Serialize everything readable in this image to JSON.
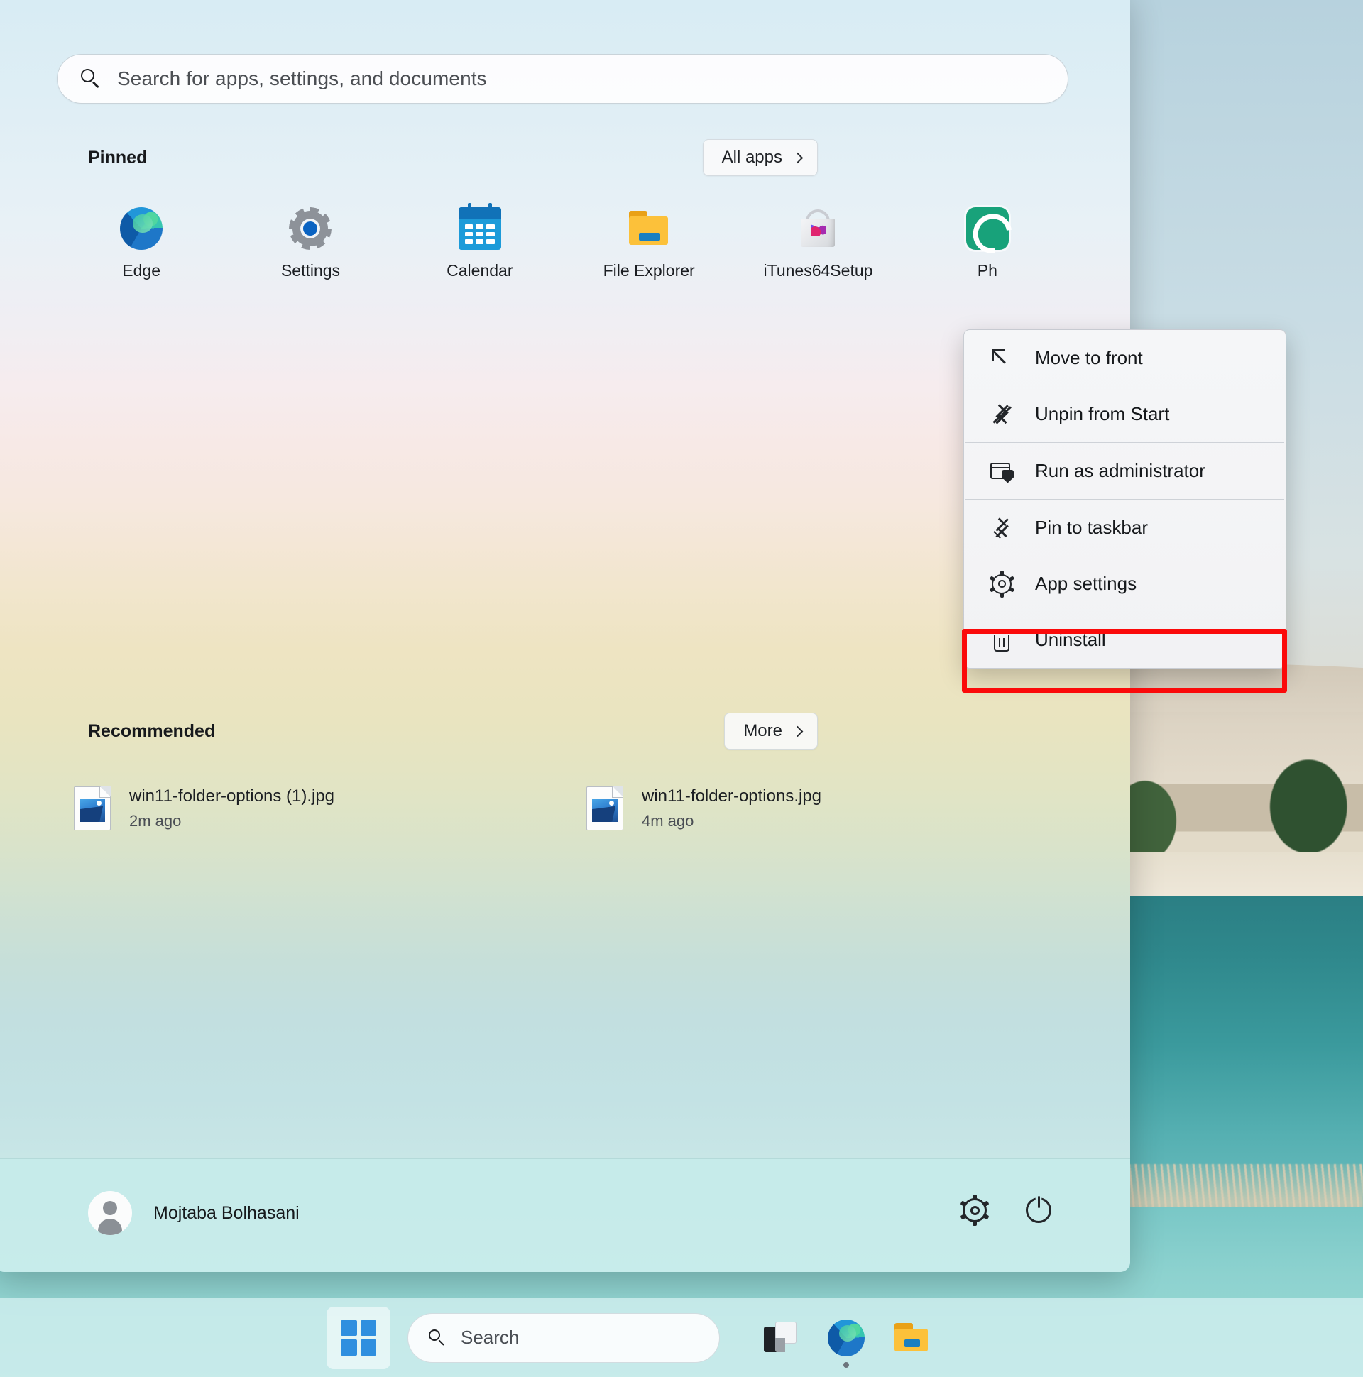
{
  "start_menu": {
    "search": {
      "placeholder": "Search for apps, settings, and documents",
      "icon": "search-icon"
    },
    "pinned": {
      "title": "Pinned",
      "all_apps_label": "All apps",
      "all_apps_chevron": "chevron-right-icon",
      "apps": [
        {
          "label": "Edge",
          "icon": "edge-icon"
        },
        {
          "label": "Settings",
          "icon": "settings-gear-icon"
        },
        {
          "label": "Calendar",
          "icon": "calendar-icon"
        },
        {
          "label": "File Explorer",
          "icon": "folder-icon"
        },
        {
          "label": "iTunes64Setup",
          "icon": "itunes-installer-icon"
        },
        {
          "label": "Ph",
          "icon": "photopea-icon"
        }
      ]
    },
    "recommended": {
      "title": "Recommended",
      "more_label": "More",
      "more_chevron": "chevron-right-icon",
      "items": [
        {
          "name": "win11-folder-options (1).jpg",
          "time": "2m ago",
          "icon": "image-file-icon"
        },
        {
          "name": "win11-folder-options.jpg",
          "time": "4m ago",
          "icon": "image-file-icon"
        }
      ]
    },
    "footer": {
      "user_name": "Mojtaba Bolhasani",
      "avatar_icon": "user-avatar-icon",
      "settings_icon": "gear-icon",
      "power_icon": "power-icon"
    }
  },
  "context_menu": {
    "items": [
      {
        "label": "Move to front",
        "icon": "move-to-front-arrow-icon"
      },
      {
        "label": "Unpin from Start",
        "icon": "unpin-icon"
      },
      {
        "label": "Run as administrator",
        "icon": "shield-admin-icon"
      },
      {
        "label": "Pin to taskbar",
        "icon": "pin-icon"
      },
      {
        "label": "App settings",
        "icon": "gear-icon"
      },
      {
        "label": "Uninstall",
        "icon": "trash-icon"
      }
    ],
    "highlight": {
      "target_label": "Uninstall",
      "color": "#fb0a0a"
    }
  },
  "taskbar": {
    "start_button_icon": "windows-logo-icon",
    "search": {
      "label": "Search",
      "icon": "search-icon"
    },
    "apps": [
      {
        "icon": "task-view-icon",
        "active": false
      },
      {
        "icon": "edge-icon",
        "active": true
      },
      {
        "icon": "file-explorer-icon",
        "active": false
      }
    ]
  }
}
